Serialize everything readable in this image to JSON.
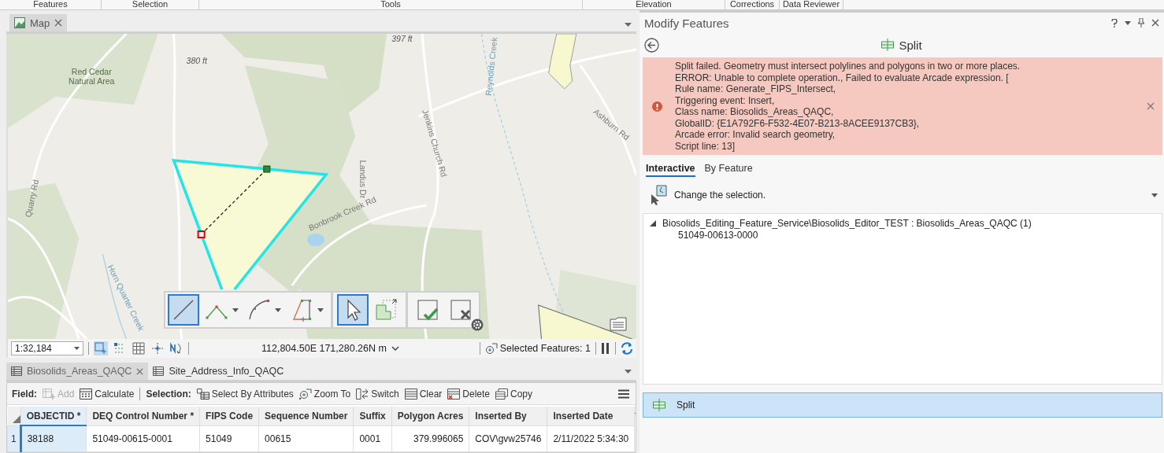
{
  "ribbon_groups": [
    {
      "label": "Features"
    },
    {
      "label": "Selection"
    },
    {
      "label": "Tools"
    },
    {
      "label": "Elevation"
    },
    {
      "label": "Corrections"
    },
    {
      "label": "Data Reviewer"
    }
  ],
  "map_view": {
    "tab": "Map",
    "labels": [
      {
        "text": "Red Cedar",
        "kind": "place"
      },
      {
        "text": "Natural Area",
        "kind": "place"
      },
      {
        "text": "380 ft",
        "kind": "elevation"
      },
      {
        "text": "397 ft",
        "kind": "elevation"
      },
      {
        "text": "Quarry Rd",
        "kind": "road"
      },
      {
        "text": "Landus Dr",
        "kind": "road"
      },
      {
        "text": "Jenkins Church Rd",
        "kind": "road"
      },
      {
        "text": "Bonbrook Creek Rd",
        "kind": "road"
      },
      {
        "text": "Reynolds Creek",
        "kind": "water"
      },
      {
        "text": "Ashburn Rd",
        "kind": "road"
      },
      {
        "text": "Horn Quarter Creek",
        "kind": "water"
      }
    ],
    "sketch_tools": [
      {
        "kind": "line",
        "selected": true,
        "dropdown": false
      },
      {
        "kind": "polyline",
        "selected": false,
        "dropdown": true
      },
      {
        "kind": "arc",
        "selected": false,
        "dropdown": true
      },
      {
        "kind": "trace",
        "selected": false,
        "dropdown": true
      },
      {
        "kind": "select",
        "selected": true,
        "dropdown": false
      },
      {
        "kind": "extend",
        "selected": false,
        "dropdown": false
      },
      {
        "kind": "finish",
        "selected": false,
        "dropdown": false
      },
      {
        "kind": "cancel",
        "selected": false,
        "dropdown": false
      }
    ]
  },
  "status_bar": {
    "scale": "1:32,184",
    "snap_tools": [
      {
        "kind": "snap",
        "selected": true
      },
      {
        "kind": "grid-snap",
        "selected": false
      },
      {
        "kind": "grid",
        "selected": false
      },
      {
        "kind": "constraints",
        "selected": false
      },
      {
        "kind": "north",
        "selected": false
      }
    ],
    "coordinates": "112,804.50E 171,280.26N m",
    "selected_features": "Selected Features: 1"
  },
  "table_tabs": [
    {
      "label": "Biosolids_Areas_QAQC",
      "selected": true
    },
    {
      "label": "Site_Address_Info_QAQC",
      "selected": false
    }
  ],
  "table_toolbar": {
    "field_label": "Field:",
    "field_buttons": [
      {
        "kind": "add",
        "label": "Add",
        "disabled": true
      },
      {
        "kind": "calculate",
        "label": "Calculate",
        "disabled": false
      }
    ],
    "selection_label": "Selection:",
    "selection_buttons": [
      {
        "kind": "select-attributes",
        "label": "Select By Attributes"
      },
      {
        "kind": "zoom",
        "label": "Zoom To"
      },
      {
        "kind": "switch",
        "label": "Switch"
      },
      {
        "kind": "clear",
        "label": "Clear"
      },
      {
        "kind": "delete",
        "label": "Delete"
      },
      {
        "kind": "copy",
        "label": "Copy"
      }
    ]
  },
  "table": {
    "columns": [
      {
        "label": "OBJECTID *",
        "selected": true
      },
      {
        "label": "DEQ Control Number *",
        "selected": false
      },
      {
        "label": "FIPS Code",
        "selected": false
      },
      {
        "label": "Sequence Number",
        "selected": false
      },
      {
        "label": "Suffix",
        "selected": false
      },
      {
        "label": "Polygon Acres",
        "selected": false
      },
      {
        "label": "Inserted By",
        "selected": false
      },
      {
        "label": "Inserted Date",
        "selected": false
      }
    ],
    "rows": [
      {
        "number": "1",
        "selected": true,
        "cells": [
          "38188",
          "51049-00615-0001",
          "51049",
          "00615",
          "0001",
          "379.996065",
          "COV\\gvw25746",
          "2/11/2022 5:34:30"
        ]
      }
    ]
  },
  "panel": {
    "title": "Modify Features",
    "tool": "Split",
    "error_lines": [
      "Split failed. Geometry must intersect polylines and polygons in two or more places.",
      "ERROR: Unable to complete operation., Failed to evaluate Arcade expression. [",
      "Rule name: Generate_FIPS_Intersect,",
      "Triggering event: Insert,",
      "Class name: Biosolids_Areas_QAQC,",
      "GlobalID: {E1A792F6-F532-4E07-B213-8ACEE9137CB3},",
      "Arcade error: Invalid search geometry,",
      "Script line: 13]"
    ],
    "tabs": [
      {
        "label": "Interactive",
        "selected": true
      },
      {
        "label": "By Feature",
        "selected": false
      }
    ],
    "selection_prompt": "Change the selection.",
    "tree": [
      {
        "label": "Biosolids_Editing_Feature_Service\\Biosolids_Editor_TEST : Biosolids_Areas_QAQC (1)",
        "expanded": true,
        "children": [
          {
            "label": "51049-00613-0000"
          }
        ]
      }
    ],
    "tools": [
      {
        "label": "Split",
        "selected": true
      }
    ]
  }
}
